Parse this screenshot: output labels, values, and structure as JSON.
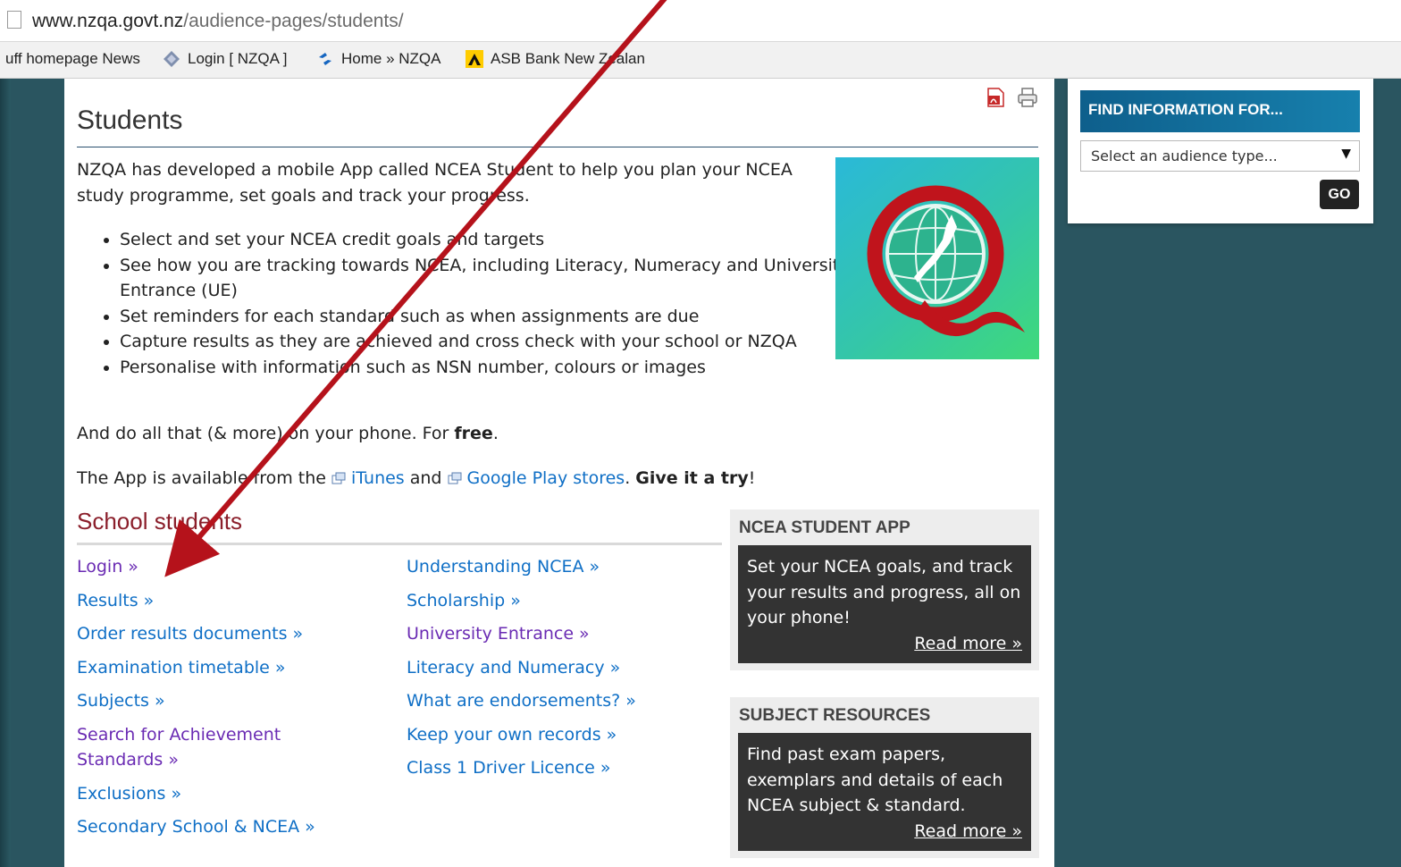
{
  "browser": {
    "url_host": "www.nzqa.govt.nz",
    "url_path": "/audience-pages/students/",
    "bookmarks": [
      {
        "label": "uff homepage News",
        "icon": "stuff-icon"
      },
      {
        "label": "Login [ NZQA ]",
        "icon": "nzqa-diamond-icon"
      },
      {
        "label": "Home » NZQA",
        "icon": "home-swirl-icon"
      },
      {
        "label": "ASB Bank New Zealan",
        "icon": "asb-logo-icon"
      }
    ]
  },
  "page": {
    "title": "Students",
    "intro": "NZQA has developed a mobile App called NCEA Student to help you plan your NCEA study programme, set goals and track your progress.",
    "bullets": [
      "Select and set your NCEA credit goals and targets",
      "See how you are tracking towards NCEA, including Literacy, Numeracy and University Entrance (UE)",
      "Set reminders for each standard such as when assignments are due",
      "Capture results as they are achieved and cross check with your school or NZQA",
      "Personalise with information such as NSN number, colours or images"
    ],
    "p2_pre": "And do all that (& more) on your phone.  For ",
    "p2_bold": "free",
    "p2_post": ".",
    "p3_pre": "The App is available from the ",
    "p3_link1": "iTunes",
    "p3_mid": " and ",
    "p3_link2": "Google Play stores",
    "p3_dot": ". ",
    "p3_bold": "Give it a try",
    "p3_end": "!"
  },
  "school_students": {
    "heading": "School students",
    "col_a": [
      "Login »",
      "Results »",
      "Order results documents »",
      "Examination timetable »",
      "Subjects »",
      "Search for Achievement Standards »",
      "Exclusions »",
      "Secondary School & NCEA »"
    ],
    "col_b": [
      "Understanding NCEA »",
      "Scholarship »",
      "University Entrance »",
      "Literacy and Numeracy »",
      "What are endorsements? »",
      "Keep your own records »",
      "Class 1 Driver Licence »"
    ]
  },
  "promos": {
    "app": {
      "title": "NCEA STUDENT APP",
      "text": "Set your NCEA goals, and track your results and progress, all on your phone!",
      "more": "Read more »"
    },
    "resources": {
      "title": "SUBJECT RESOURCES",
      "text": "Find past exam papers, exemplars and details of each NCEA subject & standard.",
      "more": "Read more »"
    }
  },
  "sidebar": {
    "heading": "FIND INFORMATION FOR...",
    "select_value": "Select an audience type...",
    "go_label": "GO"
  },
  "colors": {
    "link": "#0f6fc6",
    "visited": "#6a2bb3",
    "section_title": "#8b1f2b",
    "annotation_arrow": "#b5121b"
  }
}
